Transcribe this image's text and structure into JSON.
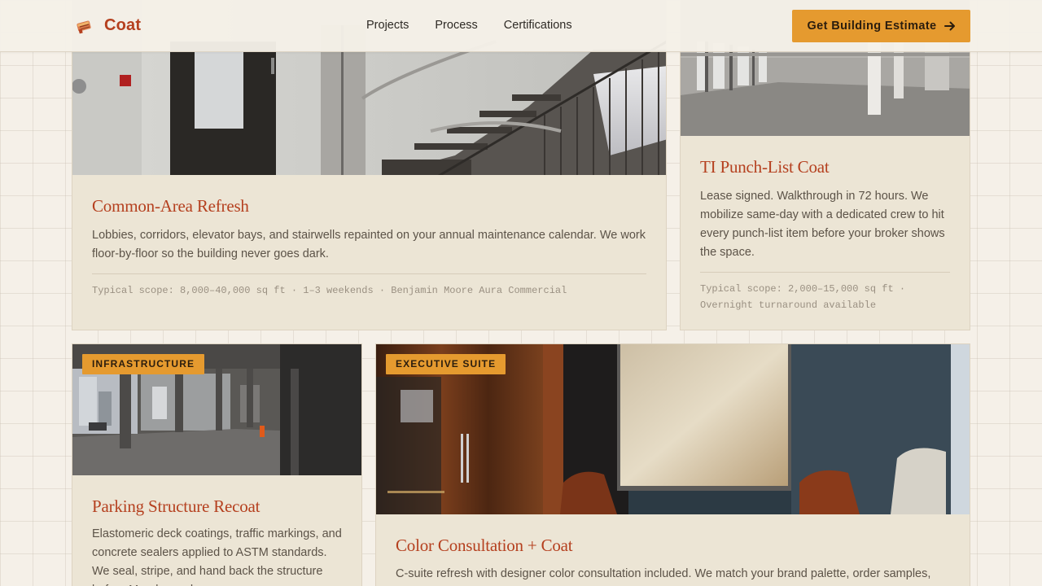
{
  "header": {
    "brand_name": "Coat",
    "nav": [
      "Projects",
      "Process",
      "Certifications"
    ],
    "cta_label": "Get Building Estimate"
  },
  "cards": [
    {
      "title": "Common-Area Refresh",
      "description": "Lobbies, corridors, elevator bays, and stairwells repainted on your annual maintenance calendar. We work floor-by-floor so the building never goes dark.",
      "scope": "Typical scope: 8,000–40,000 sq ft · 1–3 weekends · Benjamin Moore Aura Commercial"
    },
    {
      "title": "TI Punch-List Coat",
      "description": "Lease signed. Walkthrough in 72 hours. We mobilize same-day with a dedicated crew to hit every punch-list item before your broker shows the space.",
      "scope": "Typical scope: 2,000–15,000 sq ft · Overnight turnaround available"
    },
    {
      "badge": "INFRASTRUCTURE",
      "title": "Parking Structure Recoat",
      "description": "Elastomeric deck coatings, traffic markings, and concrete sealers applied to ASTM standards. We seal, stripe, and hand back the structure before Monday rush."
    },
    {
      "badge": "EXECUTIVE SUITE",
      "title": "Color Consultation + Coat",
      "description": "C-suite refresh with designer color consultation included. We match your brand palette, order samples, and schedule the work."
    }
  ],
  "colors": {
    "accent": "#b5401f",
    "cta": "#e59a2f",
    "page_bg": "#f5f0e8",
    "card_bg": "#ece5d5"
  },
  "icons": {
    "logo": "paint-roller-logo-icon",
    "cta": "arrow-right-icon"
  }
}
